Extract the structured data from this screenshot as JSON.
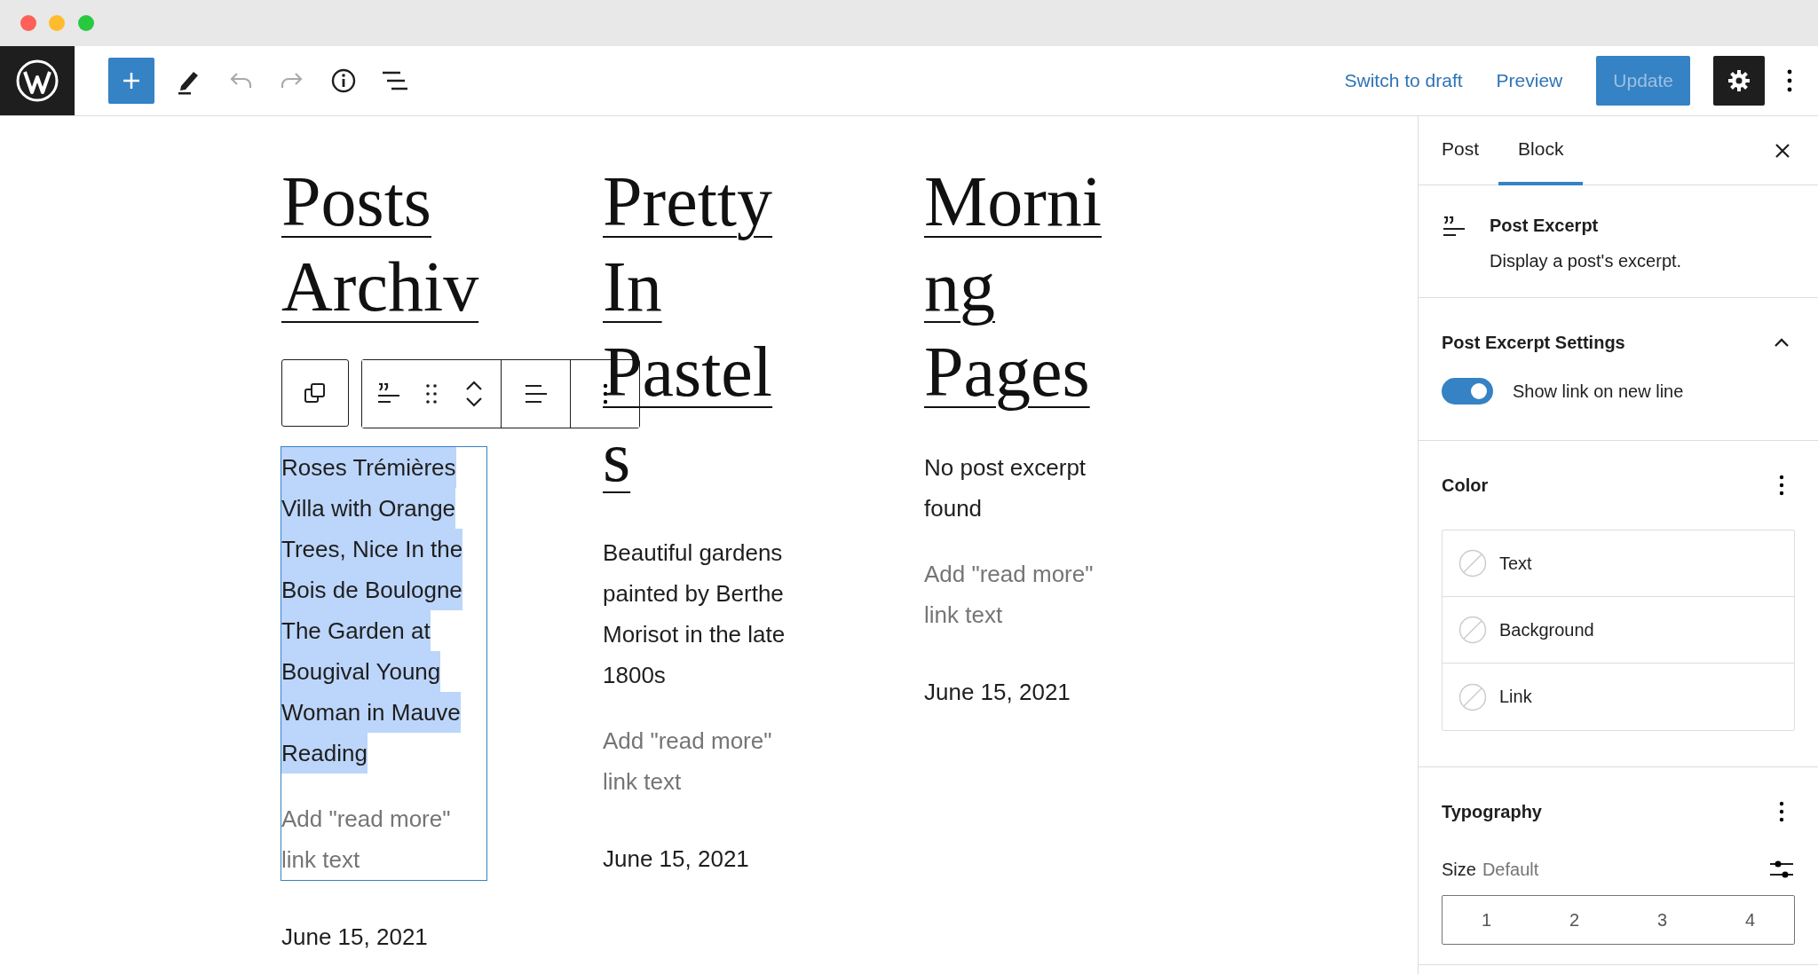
{
  "topbar": {
    "links": [
      "Switch to draft",
      "Preview"
    ],
    "update_button": {
      "label": "Update",
      "disabled": true
    }
  },
  "posts": [
    {
      "title_lines": [
        "Posts",
        "Archiv"
      ],
      "excerpt": "Roses Trémières Villa with Orange Trees, Nice In the Bois de Boulogne The Garden at Bougival Young Woman in Mauve Reading",
      "selected": true,
      "read_more": "Add \"read more\" link text",
      "date": "June 15, 2021"
    },
    {
      "title_lines": [
        "Pretty",
        "In",
        "Pastel",
        "s"
      ],
      "excerpt": "Beautiful gardens painted by Berthe Morisot in the late 1800s",
      "selected": false,
      "read_more": "Add \"read more\" link text",
      "date": "June 15, 2021"
    },
    {
      "title_lines": [
        "Morni",
        "ng",
        "Pages"
      ],
      "excerpt": "No post excerpt found",
      "selected": false,
      "read_more": "Add \"read more\" link text",
      "date": "June 15, 2021"
    }
  ],
  "sidebar": {
    "tabs": [
      {
        "label": "Post",
        "selected": false
      },
      {
        "label": "Block",
        "selected": true
      }
    ],
    "block": {
      "name": "Post Excerpt",
      "description": "Display a post's excerpt."
    },
    "settings_panel": {
      "title": "Post Excerpt Settings",
      "expanded": true,
      "toggle": {
        "label": "Show link on new line",
        "on": true
      }
    },
    "color_panel": {
      "title": "Color",
      "items": [
        "Text",
        "Background",
        "Link"
      ]
    },
    "typography_panel": {
      "title": "Typography",
      "size_label": "Size",
      "size_value": "Default",
      "size_options": [
        {
          "label": "1",
          "selected": false
        },
        {
          "label": "2",
          "selected": false
        },
        {
          "label": "3",
          "selected": false
        },
        {
          "label": "4",
          "selected": false
        }
      ]
    }
  }
}
